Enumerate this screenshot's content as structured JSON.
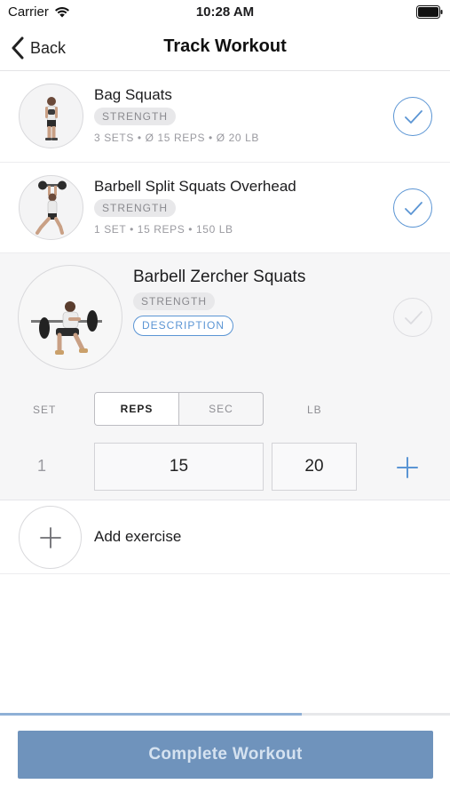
{
  "status_bar": {
    "carrier": "Carrier",
    "time": "10:28 AM"
  },
  "nav": {
    "back_label": "Back",
    "title": "Track Workout"
  },
  "exercises": [
    {
      "name": "Bag Squats",
      "category": "STRENGTH",
      "meta": "3 SETS • Ø 15 REPS • Ø 20 LB",
      "completed": true
    },
    {
      "name": "Barbell Split Squats Overhead",
      "category": "STRENGTH",
      "meta": "1 SET • 15 REPS • 150 LB",
      "completed": true
    },
    {
      "name": "Barbell Zercher Squats",
      "category": "STRENGTH",
      "description_label": "DESCRIPTION",
      "completed": false
    }
  ],
  "set_table": {
    "set_label": "SET",
    "unit_options": [
      "REPS",
      "SEC"
    ],
    "selected_unit": "REPS",
    "weight_label": "LB",
    "rows": [
      {
        "set": "1",
        "reps": "15",
        "weight": "20"
      }
    ]
  },
  "add_exercise_label": "Add exercise",
  "progress": {
    "fraction": 0.67
  },
  "complete_button_label": "Complete Workout",
  "colors": {
    "accent": "#5b95d4",
    "complete_button": "#6f93bc",
    "complete_text": "#d5e2f0"
  }
}
